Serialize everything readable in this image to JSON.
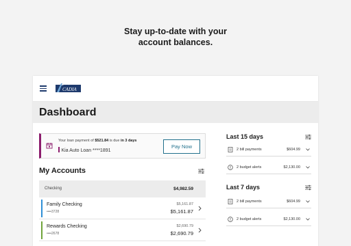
{
  "headline": {
    "line1": "Stay up-to-date with your",
    "line2": "account balances."
  },
  "app": {
    "brand_color": "#1e3a6d",
    "accent_color": "#1f6f8b",
    "logo_alt": "Acadia logo"
  },
  "dashboard": {
    "title": "Dashboard"
  },
  "alert": {
    "prefix": "Your loan payment of ",
    "amount": "$521.84",
    "middle": " is due ",
    "due": "in 3 days",
    "account": "Kia Auto Loan ****1891",
    "pay_label": "Pay Now",
    "accent_color": "#8c1d6d"
  },
  "accounts": {
    "title": "My Accounts",
    "group_label": "Checking",
    "group_total": "$4,982.59",
    "rows": [
      {
        "name": "Family Checking",
        "number": "••••3728",
        "available": "$5,161.87",
        "balance": "$5,161.87",
        "color": "#2e8fd6"
      },
      {
        "name": "Rewards Checking",
        "number": "••••2678",
        "available": "$2,690.79",
        "balance": "$2,690.79",
        "color": "#6fa33a"
      }
    ]
  },
  "summary": {
    "sections": [
      {
        "title": "Last 15 days",
        "items": [
          {
            "icon": "bill-icon",
            "label": "2 bill payments",
            "amount": "$604.99"
          },
          {
            "icon": "alert-circle-icon",
            "label": "2 budget alerts",
            "amount": "$2,130.00"
          }
        ]
      },
      {
        "title": "Last 7 days",
        "items": [
          {
            "icon": "bill-icon",
            "label": "2 bill payments",
            "amount": "$604.99"
          },
          {
            "icon": "alert-circle-icon",
            "label": "2 budget alerts",
            "amount": "$2,130.00"
          }
        ]
      }
    ]
  }
}
